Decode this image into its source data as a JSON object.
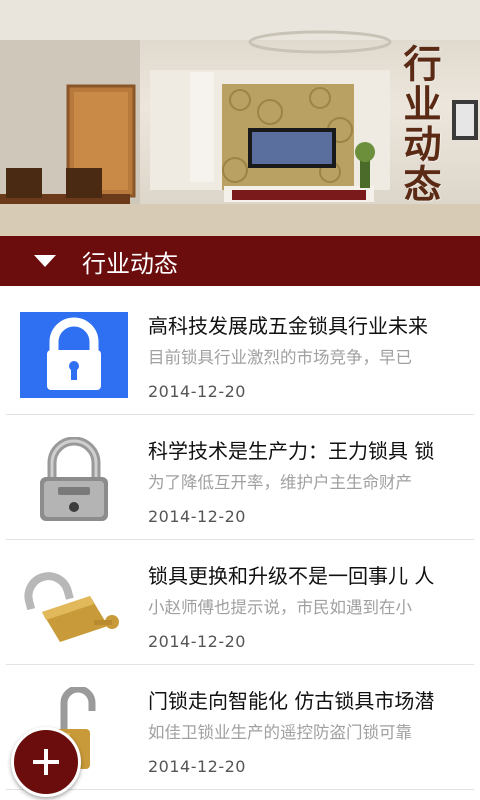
{
  "banner": {
    "caption": "行业动态"
  },
  "section": {
    "title": "行业动态"
  },
  "news": [
    {
      "title": "高科技发展成五金锁具行业未来",
      "summary": "目前锁具行业激烈的市场竞争，早已",
      "date": "2014-12-20",
      "thumb_icon": "blue-padlock-icon"
    },
    {
      "title": "科学技术是生产力：王力锁具 锁",
      "summary": "为了降低互开率，维护户主生命财产",
      "date": "2014-12-20",
      "thumb_icon": "silver-padlock-icon"
    },
    {
      "title": "锁具更换和升级不是一回事儿 人",
      "summary": "小赵师傅也提示说，市民如遇到在小",
      "date": "2014-12-20",
      "thumb_icon": "brass-padlock-with-key-icon"
    },
    {
      "title": "门锁走向智能化 仿古锁具市场潜",
      "summary": "如佳卫锁业生产的遥控防盗门锁可靠",
      "date": "2014-12-20",
      "thumb_icon": "open-padlock-icon"
    }
  ],
  "colors": {
    "header_bg": "#6b0d0d",
    "title_text": "#111111",
    "summary_text": "#a0a0a0"
  }
}
